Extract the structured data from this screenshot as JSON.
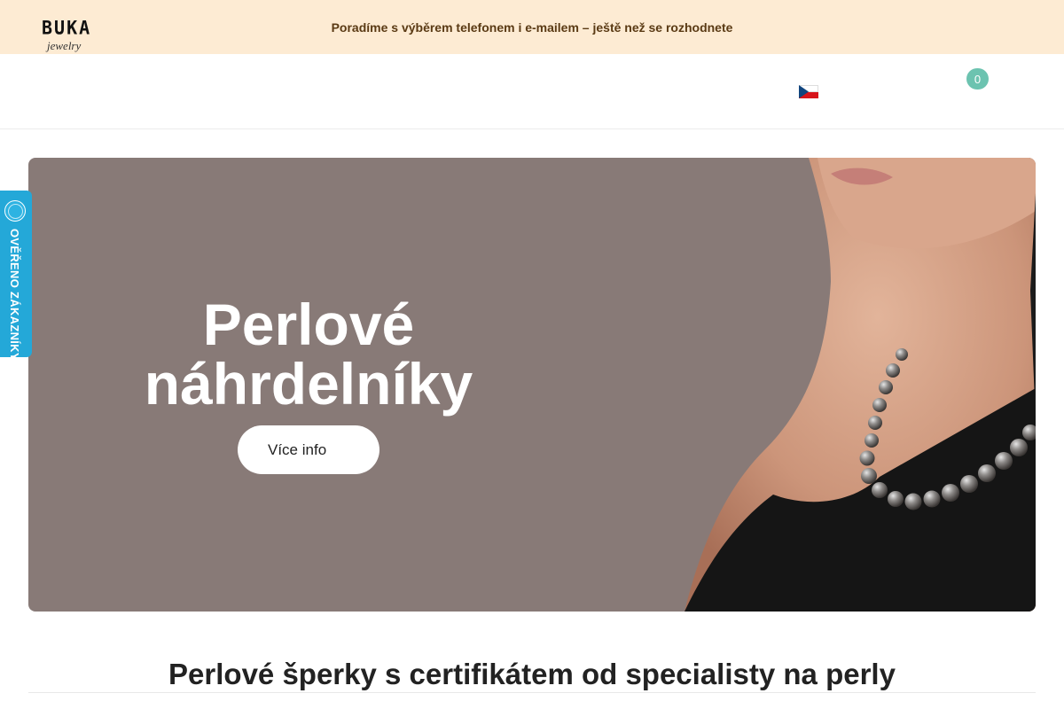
{
  "topbar": {
    "text": "Poradíme s výběrem telefonem i e-mailem – ještě než se rozhodnete"
  },
  "header": {
    "logo": {
      "brand": "BUKA",
      "sub": "jewelry"
    },
    "cart": {
      "count": "0"
    },
    "language_flag": "flag-cz-icon"
  },
  "verified_badge": {
    "text": "OVĚŘENO ZÁKAZNÍKY"
  },
  "hero": {
    "title_line1": "Perlové",
    "title_line2": "náhrdelníky",
    "button": "Více info",
    "background": "#887a77"
  },
  "section": {
    "title": "Perlové šperky s certifikátem od specialisty na perly"
  },
  "colors": {
    "topbar_bg": "#fdebd3",
    "topbar_text": "#5a3a14",
    "accent": "#6cc3b0",
    "badge": "#24a8d8"
  }
}
